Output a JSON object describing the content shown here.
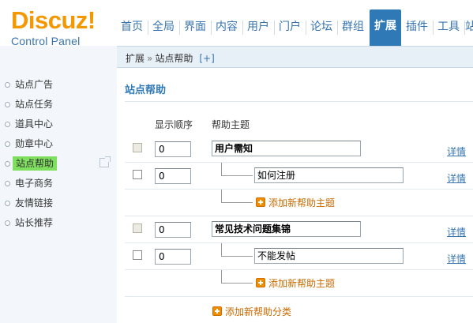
{
  "logo": {
    "main": "Discuz!",
    "sub": "Control Panel"
  },
  "nav": [
    "首页",
    "全局",
    "界面",
    "内容",
    "用户",
    "门户",
    "论坛",
    "群组",
    "扩展",
    "插件",
    "工具",
    "站"
  ],
  "nav_active": "扩展",
  "sidebar": {
    "items": [
      {
        "label": "站点广告"
      },
      {
        "label": "站点任务"
      },
      {
        "label": "道具中心"
      },
      {
        "label": "勋章中心"
      },
      {
        "label": "站点帮助"
      },
      {
        "label": "电子商务"
      },
      {
        "label": "友情链接"
      },
      {
        "label": "站长推荐"
      }
    ],
    "active": "站点帮助"
  },
  "breadcrumb": {
    "parent": "扩展",
    "separator": "»",
    "current": "站点帮助",
    "toggle": "[+]"
  },
  "main": {
    "title": "站点帮助",
    "col_order": "显示顺序",
    "col_topic": "帮助主题",
    "rows": [
      {
        "order": "0",
        "name": "用户需知",
        "detail": "详情"
      },
      {
        "order": "0",
        "name": "如何注册",
        "detail": "详情"
      },
      {
        "order": "0",
        "name": "常见技术问题集锦",
        "detail": "详情"
      },
      {
        "order": "0",
        "name": "不能发帖",
        "detail": "详情"
      }
    ],
    "add_topic": "添加新帮助主题",
    "add_category": "添加新帮助分类"
  },
  "colors": {
    "accent": "#2f79b6",
    "logo": "#f39800",
    "highlight": "#7fe05f",
    "add_link": "#c96a00"
  }
}
